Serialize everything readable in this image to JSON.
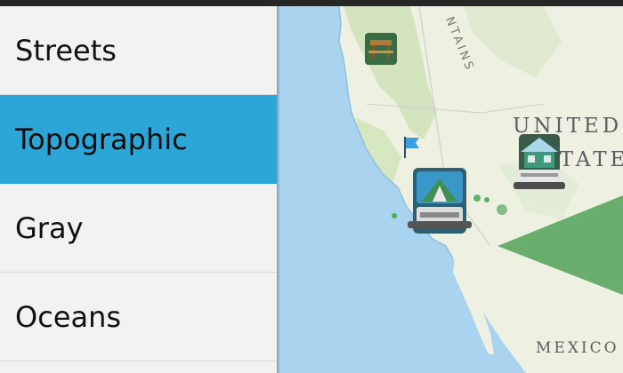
{
  "sidebar": {
    "items": [
      {
        "label": "Streets"
      },
      {
        "label": "Topographic"
      },
      {
        "label": "Gray"
      },
      {
        "label": "Oceans"
      }
    ],
    "selected_index": 1
  },
  "map": {
    "basemap": "Topographic",
    "labels": {
      "country_line1": "UNITED",
      "country_line2": "STATES",
      "mexico": "MEXICO",
      "mountains": "NTAINS"
    },
    "markers": [
      {
        "icon": "picnic-table-icon"
      },
      {
        "icon": "flag-icon"
      },
      {
        "icon": "campground-icon"
      },
      {
        "icon": "ranger-station-icon"
      }
    ],
    "colors": {
      "ocean": "#a9d3ef",
      "land": "#eef0e2",
      "vegetation": "#c7ddb0",
      "selection": "#2ba6d6",
      "overlay_triangle": "#6aae6e"
    }
  }
}
